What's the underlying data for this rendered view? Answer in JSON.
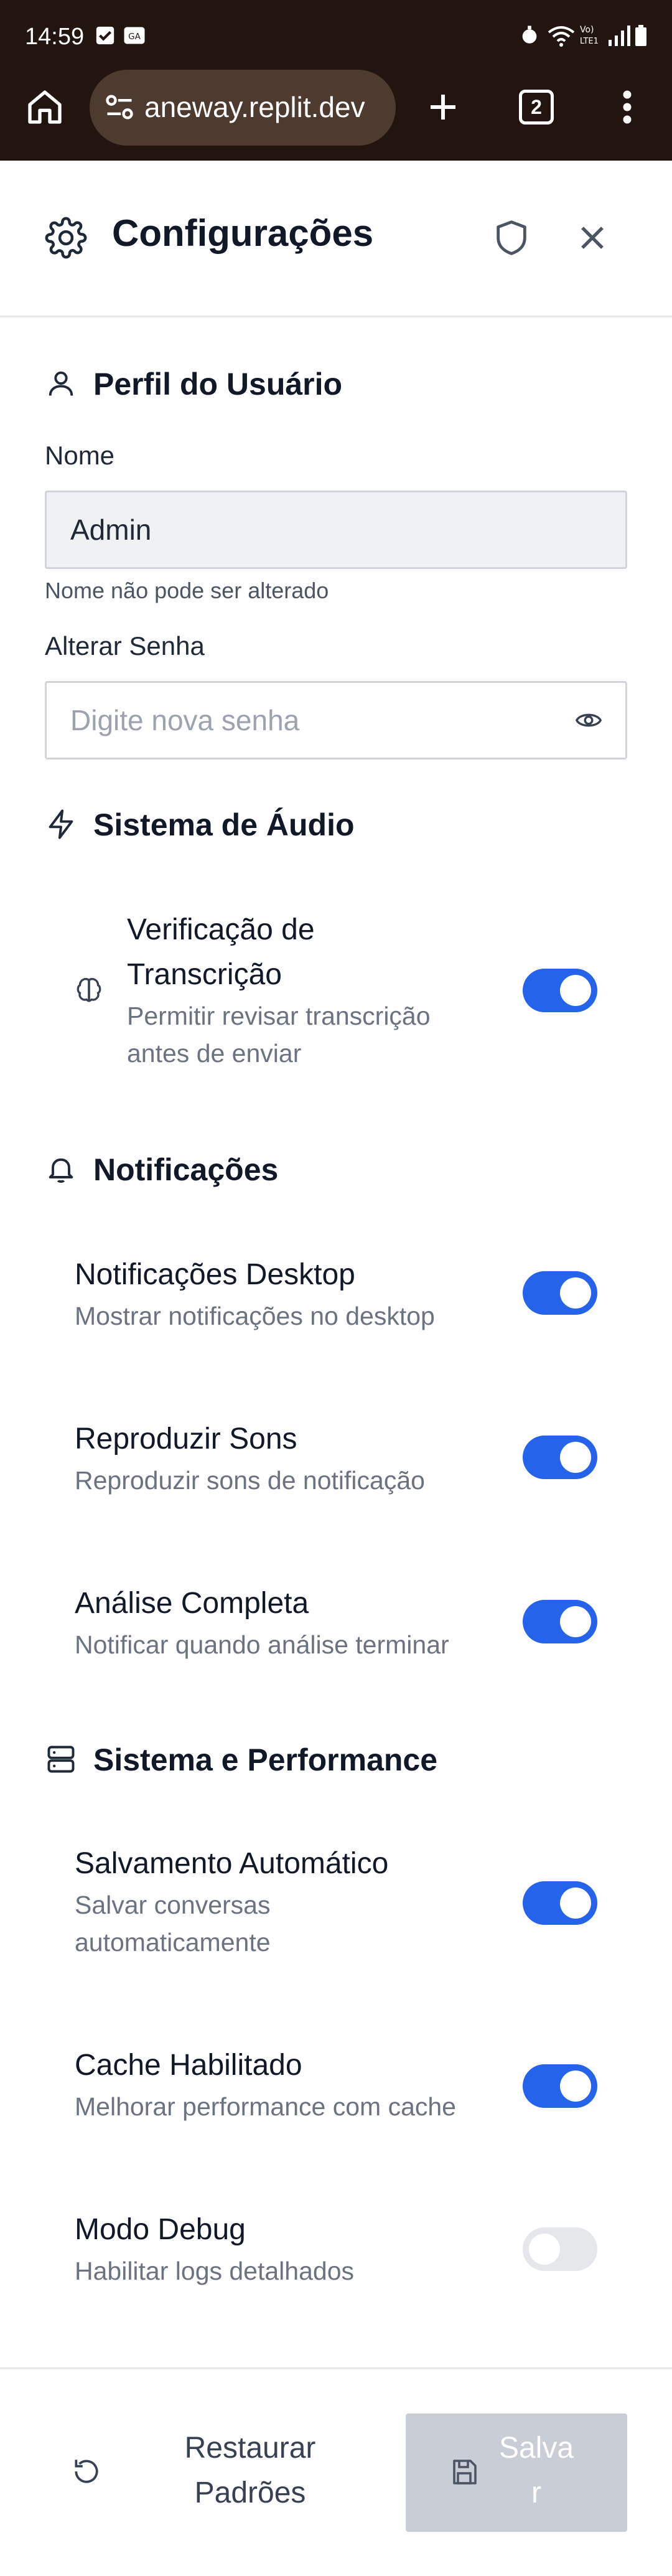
{
  "status_bar": {
    "time": "14:59"
  },
  "browser": {
    "url": "aneway.replit.dev",
    "tab_count": "2"
  },
  "header": {
    "title": "Configurações"
  },
  "profile": {
    "title": "Perfil do Usuário",
    "name_label": "Nome",
    "name_value": "Admin",
    "name_help": "Nome não pode ser alterado",
    "password_label": "Alterar Senha",
    "password_placeholder": "Digite nova senha"
  },
  "audio": {
    "title": "Sistema de Áudio",
    "items": [
      {
        "title_line1": "Verificação de",
        "title_line2": "Transcrição",
        "desc_line1": "Permitir revisar transcrição",
        "desc_line2": "antes de enviar",
        "enabled": true
      }
    ]
  },
  "notifications": {
    "title": "Notificações",
    "items": [
      {
        "title": "Notificações Desktop",
        "desc": "Mostrar notificações no desktop",
        "enabled": true
      },
      {
        "title": "Reproduzir Sons",
        "desc": "Reproduzir sons de notificação",
        "enabled": true
      },
      {
        "title": "Análise Completa",
        "desc": "Notificar quando análise terminar",
        "enabled": true
      }
    ]
  },
  "performance": {
    "title": "Sistema e Performance",
    "items": [
      {
        "title": "Salvamento Automático",
        "desc_line1": "Salvar conversas",
        "desc_line2": "automaticamente",
        "enabled": true
      },
      {
        "title": "Cache Habilitado",
        "desc": "Melhorar performance com cache",
        "enabled": true
      },
      {
        "title": "Modo Debug",
        "desc": "Habilitar logs detalhados",
        "enabled": false
      }
    ]
  },
  "footer": {
    "reset_line1": "Restaurar",
    "reset_line2": "Padrões",
    "save_line1": "Salva",
    "save_line2": "r"
  },
  "colors": {
    "accent": "#2563eb",
    "toggle_off": "#e5e7eb",
    "browser_bar": "#22150f",
    "url_pill": "#4d3b2f",
    "save_disabled": "#c8cdd6"
  }
}
